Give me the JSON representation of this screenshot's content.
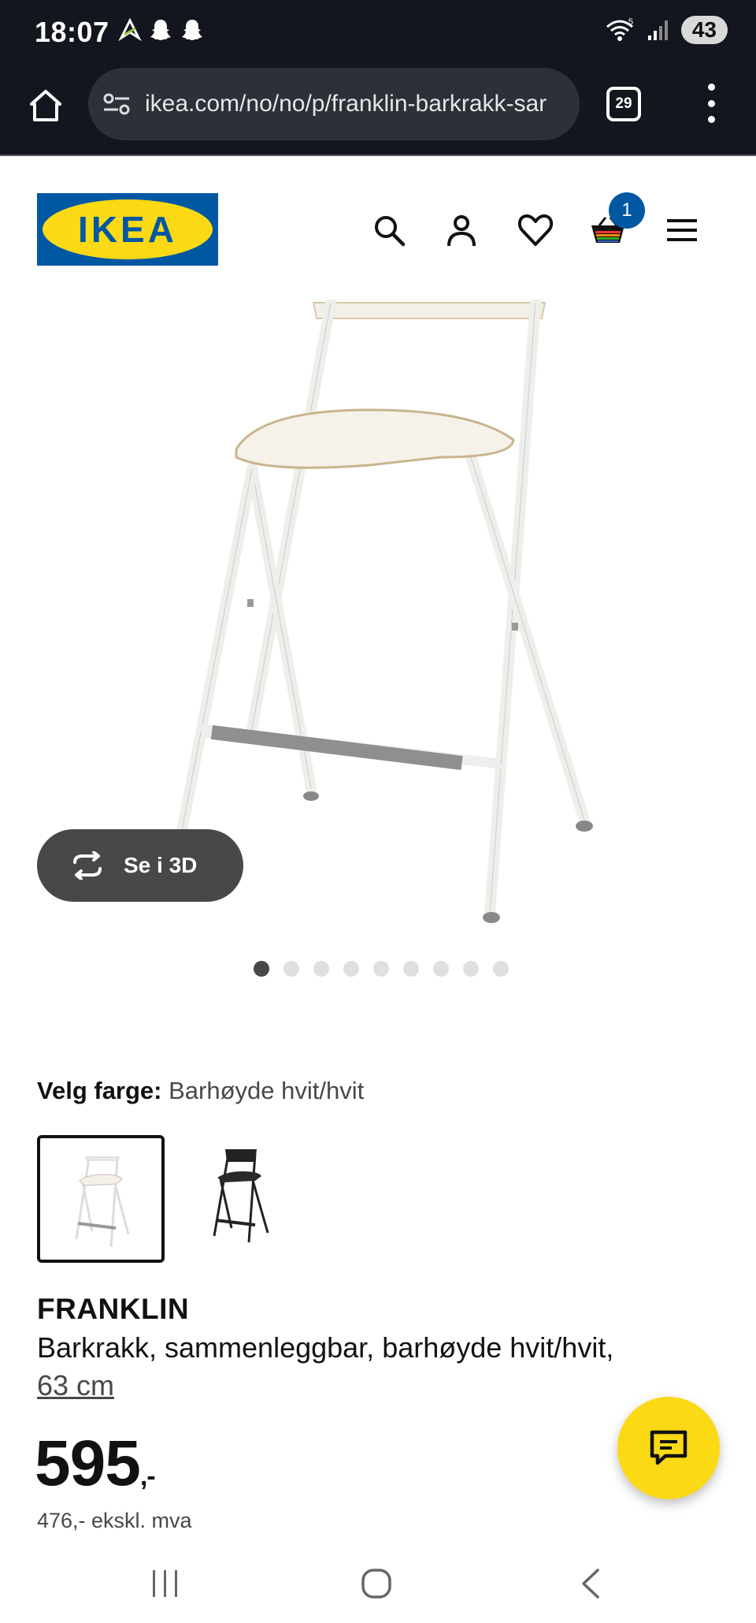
{
  "status_bar": {
    "time": "18:07",
    "battery": "43",
    "wifi_label": "5"
  },
  "browser": {
    "url": "ikea.com/no/no/p/franklin-barkrakk-sar",
    "tab_count": "29"
  },
  "header": {
    "logo_text": "IKEA",
    "cart_count": "1",
    "icons": [
      "search-icon",
      "account-icon",
      "heart-icon",
      "cart-icon",
      "hamburger-menu-icon"
    ]
  },
  "gallery": {
    "view_3d_label": "Se i 3D",
    "image_count": 9,
    "active_index": 0
  },
  "color_picker": {
    "label": "Velg farge:",
    "selected": "Barhøyde hvit/hvit",
    "options": [
      "white",
      "black"
    ]
  },
  "product": {
    "name": "FRANKLIN",
    "description": "Barkrakk, sammenleggbar, barhøyde hvit/hvit,",
    "size": "63 cm",
    "price": "595",
    "price_suffix": ",-",
    "price_ex_vat": "476,- ekskl. mva"
  },
  "colors": {
    "ikea_blue": "#0058a3",
    "ikea_yellow": "#fbd914",
    "dark_bar": "#14161f"
  }
}
